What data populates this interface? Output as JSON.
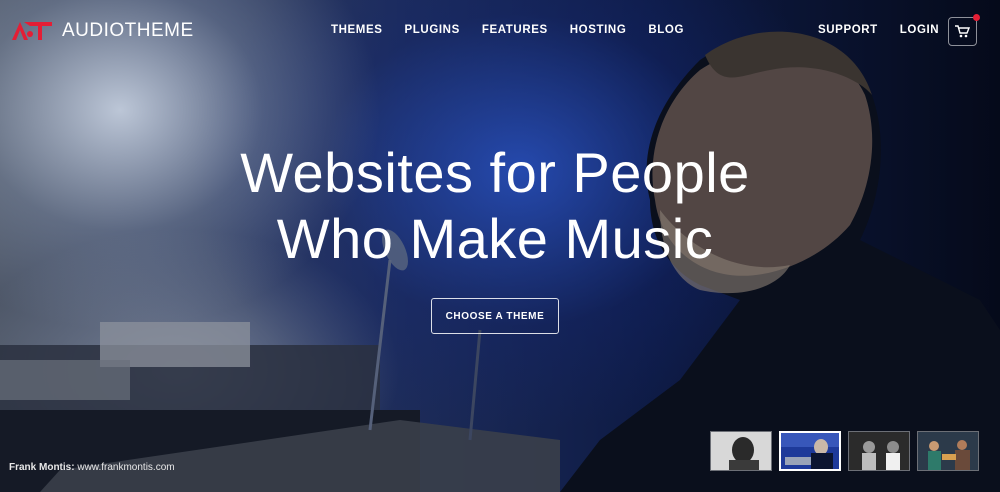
{
  "brand": {
    "name": "AUDIOTHEME",
    "accent": "#e41e35"
  },
  "nav": {
    "menu": [
      "THEMES",
      "PLUGINS",
      "FEATURES",
      "HOSTING",
      "BLOG"
    ],
    "right": [
      "SUPPORT",
      "LOGIN"
    ],
    "cart_icon": "cart-icon"
  },
  "hero": {
    "headline_line1": "Websites for People",
    "headline_line2": "Who Make Music",
    "cta_label": "CHOOSE A THEME",
    "credit_name": "Frank Montis:",
    "credit_url": "www.frankmontis.com"
  },
  "slides": {
    "count": 4,
    "active_index": 1
  }
}
